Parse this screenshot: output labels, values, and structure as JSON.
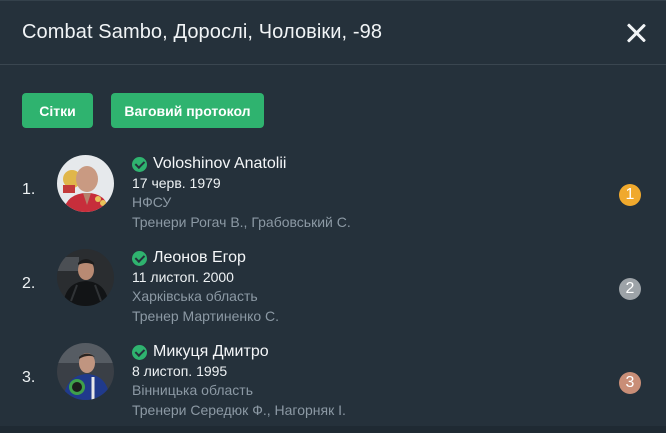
{
  "header": {
    "title": "Combat Sambo, Дорослі, Чоловіки, -98"
  },
  "actions": {
    "grids_label": "Сітки",
    "weigh_label": "Ваговий протокол"
  },
  "colors": {
    "accent": "#2fb36f",
    "gold": "#f0a92d",
    "silver": "#9da3a8",
    "bronze": "#c98e77"
  },
  "results": [
    {
      "place": "1.",
      "name": "Voloshinov Anatolii",
      "dob": "17 черв. 1979",
      "region": "НФСУ",
      "coach": "Тренери Рогач В.,  Грабовський С.",
      "medal": "1",
      "medal_color": "#f0a92d"
    },
    {
      "place": "2.",
      "name": "Леонов Егор",
      "dob": "11 листоп. 2000",
      "region": "Харківська область",
      "coach": "Тренер Мартиненко С.",
      "medal": "2",
      "medal_color": "#9da3a8"
    },
    {
      "place": "3.",
      "name": "Микуця Дмитро",
      "dob": "8 листоп. 1995",
      "region": "Вінницька область",
      "coach": "Тренери Середюк Ф.,  Нагорняк І.",
      "medal": "3",
      "medal_color": "#c98e77"
    }
  ]
}
